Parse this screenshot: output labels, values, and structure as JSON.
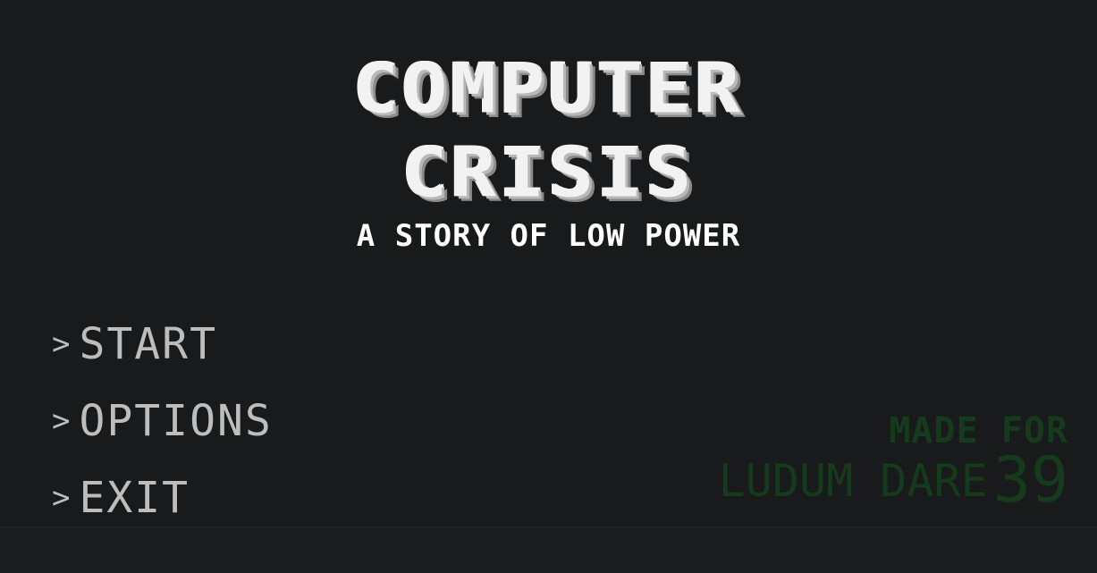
{
  "title": {
    "line1": "COMPUTER",
    "line2": "CRISIS",
    "subtitle": "A STORY OF LOW POWER"
  },
  "menu": {
    "caret": ">",
    "items": [
      {
        "label": "START"
      },
      {
        "label": "OPTIONS"
      },
      {
        "label": "EXIT"
      }
    ]
  },
  "badge": {
    "top": "MADE FOR",
    "bottom": "LUDUM DARE",
    "number": "39"
  },
  "colors": {
    "background": "#181a1c",
    "title": "#f2f2f2",
    "menu_text": "#bdbdbd",
    "badge": "#153a1c"
  }
}
